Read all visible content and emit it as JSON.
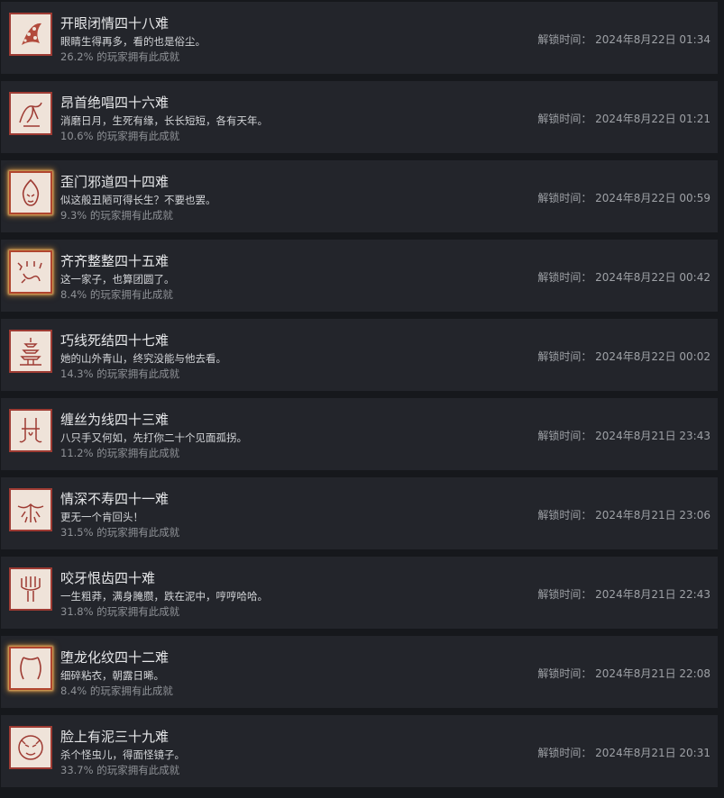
{
  "unlock_prefix": "解锁时间：",
  "pct_suffix": "的玩家拥有此成就",
  "achievements": [
    {
      "title": "开眼闭情四十八难",
      "desc": "眼睛生得再多，看的也是俗尘。",
      "pct": "26.2%",
      "time": "2024年8月22日 01:34",
      "icon": "eye-cluster-icon",
      "rare": false
    },
    {
      "title": "昂首绝唱四十六难",
      "desc": "消磨日月，生死有缘，长长短短，各有天年。",
      "pct": "10.6%",
      "time": "2024年8月22日 01:21",
      "icon": "rooster-icon",
      "rare": false
    },
    {
      "title": "歪门邪道四十四难",
      "desc": "似这般丑陋可得长生？不要也罢。",
      "pct": "9.3%",
      "time": "2024年8月22日 00:59",
      "icon": "flame-face-icon",
      "rare": true
    },
    {
      "title": "齐齐整整四十五难",
      "desc": "这一家子，也算团圆了。",
      "pct": "8.4%",
      "time": "2024年8月22日 00:42",
      "icon": "scorpion-family-icon",
      "rare": true
    },
    {
      "title": "巧线死结四十七难",
      "desc": "她的山外青山，终究没能与他去看。",
      "pct": "14.3%",
      "time": "2024年8月22日 00:02",
      "icon": "pagoda-icon",
      "rare": false
    },
    {
      "title": "缠丝为线四十三难",
      "desc": "八只手又何如，先打你二十个见面孤拐。",
      "pct": "11.2%",
      "time": "2024年8月21日 23:43",
      "icon": "spider-thread-icon",
      "rare": false
    },
    {
      "title": "情深不寿四十一难",
      "desc": "更无一个肯回头！",
      "pct": "31.5%",
      "time": "2024年8月21日 23:06",
      "icon": "centipede-icon",
      "rare": false
    },
    {
      "title": "咬牙恨齿四十难",
      "desc": "一生粗莽，满身腌臜，跌在泥中，哼哼哈哈。",
      "pct": "31.8%",
      "time": "2024年8月21日 22:43",
      "icon": "trident-icon",
      "rare": false
    },
    {
      "title": "堕龙化纹四十二难",
      "desc": "细碎粘衣，朝露日晞。",
      "pct": "8.4%",
      "time": "2024年8月21日 22:08",
      "icon": "dragon-curve-icon",
      "rare": true
    },
    {
      "title": "脸上有泥三十九难",
      "desc": "杀个怪虫儿，得面怪镜子。",
      "pct": "33.7%",
      "time": "2024年8月21日 20:31",
      "icon": "beast-face-icon",
      "rare": false
    }
  ],
  "colors": {
    "background": "#16181c",
    "row": "#23252b",
    "title": "#e6e7e9",
    "desc": "#d3d5d8",
    "muted": "#8f9297",
    "icon_bg": "#efe3d9",
    "icon_ink": "#9e3b33",
    "rare_glow": "#de963c"
  }
}
